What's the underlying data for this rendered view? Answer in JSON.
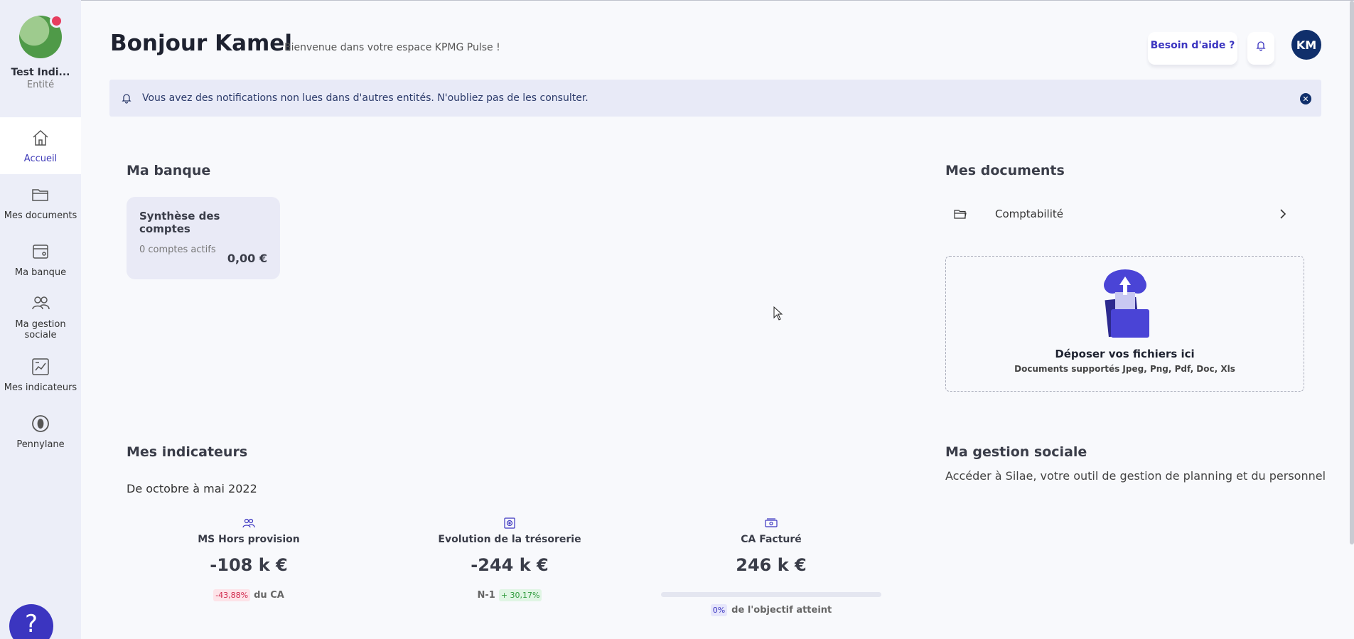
{
  "sidebar": {
    "entity_name": "Test Indi...",
    "entity_type": "Entité",
    "items": [
      {
        "label": "Accueil",
        "icon": "home-icon",
        "active": true
      },
      {
        "label": "Mes documents",
        "icon": "folder-icon",
        "active": false
      },
      {
        "label": "Ma banque",
        "icon": "wallet-icon",
        "active": false
      },
      {
        "label": "Ma gestion sociale",
        "icon": "users-icon",
        "active": false
      },
      {
        "label": "Mes indicateurs",
        "icon": "chart-icon",
        "active": false
      },
      {
        "label": "Pennylane",
        "icon": "pennylane-icon",
        "active": false
      }
    ],
    "help_fab": "?"
  },
  "header": {
    "title": "Bonjour Kamel",
    "subtitle": "Bienvenue dans votre espace KPMG Pulse !",
    "help_label": "Besoin d'aide ?",
    "avatar_initials": "KM"
  },
  "notification": {
    "text": "Vous avez des notifications non lues dans d'autres entités. N'oubliez pas de les consulter.",
    "close": "✕"
  },
  "bank": {
    "title": "Ma banque",
    "card_title": "Synthèse des comptes",
    "card_sub": "0 comptes actifs",
    "card_value": "0,00 €"
  },
  "documents": {
    "title": "Mes documents",
    "folder_label": "Comptabilité",
    "drop_title": "Déposer vos fichiers ici",
    "drop_sub": "Documents supportés Jpeg, Png, Pdf, Doc, Xls"
  },
  "indicators": {
    "title": "Mes indicateurs",
    "period": "De octobre à mai 2022",
    "kpis": [
      {
        "label": "MS Hors provision",
        "value": "-108 k €",
        "badge": "-43,88%",
        "foot": "du CA",
        "icon": "users-icon"
      },
      {
        "label": "Evolution de la trésorerie",
        "value": "-244 k €",
        "prefix": "N-1",
        "badge": "+ 30,17%",
        "icon": "safe-icon"
      },
      {
        "label": "CA Facturé",
        "value": "246 k €",
        "badge": "0%",
        "foot": "de l'objectif atteint",
        "progress": 0,
        "icon": "cash-icon"
      }
    ]
  },
  "social": {
    "title": "Ma gestion sociale",
    "text": "Accéder à Silae, votre outil de gestion de planning et du personnel"
  },
  "colors": {
    "accent": "#3b35c0",
    "navy": "#102f6b",
    "sidebar_bg": "#eceef8",
    "negative": "#d0284c",
    "positive": "#2f9a3d"
  }
}
